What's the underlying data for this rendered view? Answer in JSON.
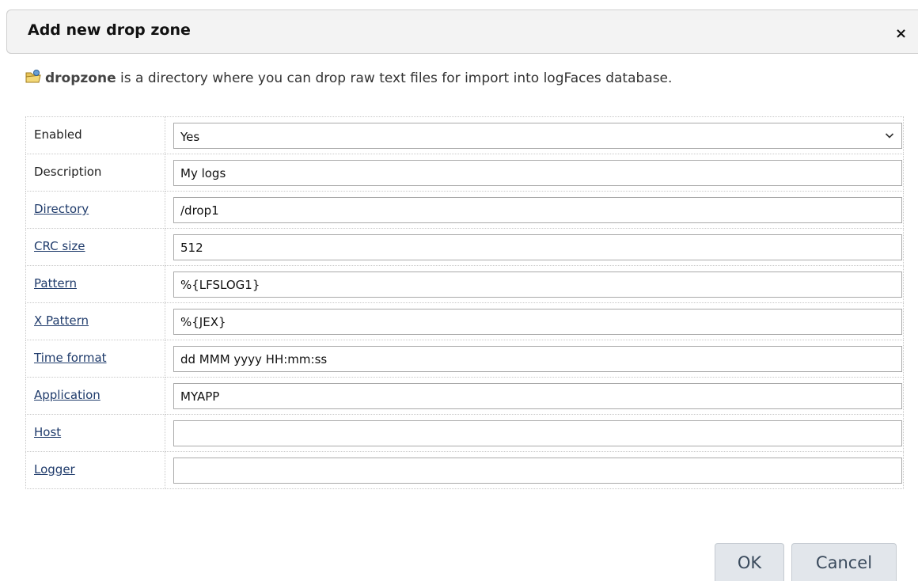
{
  "dialog": {
    "title": "Add new drop zone",
    "close_glyph": "×"
  },
  "intro": {
    "icon": "folder-edit-icon",
    "lead": "dropzone",
    "text": " is a directory where you can drop raw text files for import into logFaces database."
  },
  "form": {
    "rows": [
      {
        "label": "Enabled",
        "type": "select",
        "value": "Yes",
        "linked": false
      },
      {
        "label": "Description",
        "type": "text",
        "value": "My logs",
        "linked": false
      },
      {
        "label": "Directory",
        "type": "text",
        "value": "/drop1",
        "linked": true
      },
      {
        "label": "CRC size",
        "type": "text",
        "value": "512",
        "linked": true
      },
      {
        "label": "Pattern",
        "type": "text",
        "value": "%{LFSLOG1}",
        "linked": true
      },
      {
        "label": "X Pattern",
        "type": "text",
        "value": "%{JEX}",
        "linked": true
      },
      {
        "label": "Time format",
        "type": "text",
        "value": "dd MMM yyyy HH:mm:ss",
        "linked": true
      },
      {
        "label": "Application",
        "type": "text",
        "value": "MYAPP",
        "linked": true
      },
      {
        "label": "Host",
        "type": "text",
        "value": "",
        "linked": true
      },
      {
        "label": "Logger",
        "type": "text",
        "value": "",
        "linked": true
      }
    ]
  },
  "buttons": {
    "ok": "OK",
    "cancel": "Cancel"
  },
  "colors": {
    "header_bg": "#f3f3f3",
    "link_label": "#1f3b6b",
    "button_bg": "#e2e6eb",
    "button_text": "#3a4a5c"
  }
}
